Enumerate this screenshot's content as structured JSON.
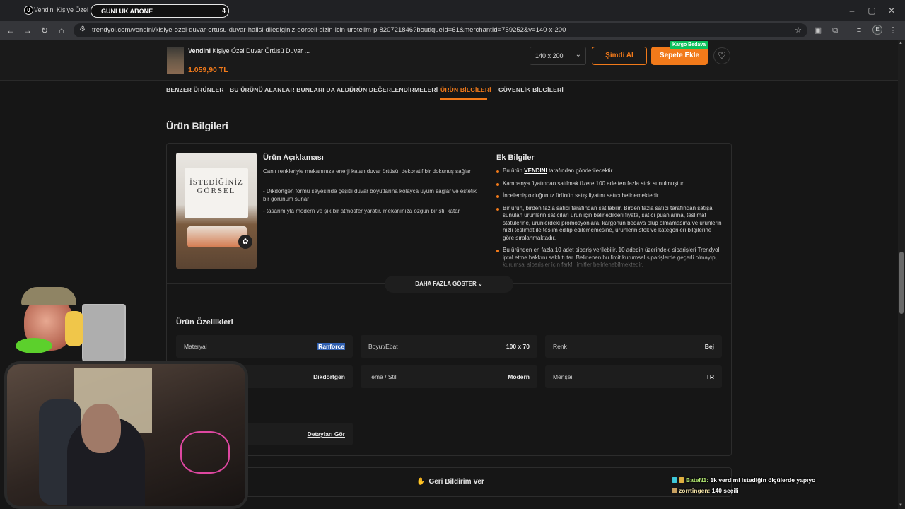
{
  "browser": {
    "tab_title": "Vendini Kişiye Özel Duvar Ö...",
    "overlay_goal_label": "GÜNLÜK ABONE",
    "overlay_goal_count": "4",
    "overlay_zero": "0",
    "url": "trendyol.com/vendini/kisiye-ozel-duvar-ortusu-duvar-halisi-dilediginiz-gorseli-sizin-icin-uretelim-p-820721846?boutiqueId=61&merchantId=759252&v=140-x-200",
    "profile_initial": "E"
  },
  "product_bar": {
    "brand": "Vendini",
    "title": "Kişiye Özel Duvar Örtüsü Duvar ...",
    "price": "1.059,90 TL",
    "size_value": "140 x 200",
    "buy_now_label": "Şimdi Al",
    "add_to_cart_label": "Sepete Ekle",
    "free_shipping_label": "Kargo Bedava"
  },
  "tabs": [
    {
      "label": "BENZER ÜRÜNLER"
    },
    {
      "label": "BU ÜRÜNÜ ALANLAR BUNLARI DA ALDI"
    },
    {
      "label": "ÜRÜN DEĞERLENDİRMELERİ"
    },
    {
      "label": "ÜRÜN BİLGİLERİ"
    },
    {
      "label": "GÜVENLİK BİLGİLERİ"
    }
  ],
  "active_tab": "ÜRÜN BİLGİLERİ",
  "section_title": "Ürün Bilgileri",
  "product_image": {
    "line1": "İSTEDİĞİNİZ",
    "line2": "GÖRSEL"
  },
  "description": {
    "title": "Ürün Açıklaması",
    "paragraphs": [
      "Canlı renkleriyle mekanınıza enerji katan duvar örtüsü, dekoratif bir dokunuş sağlar",
      "- Dikdörtgen formu sayesinde çeşitli duvar boyutlarına kolayca uyum sağlar ve estetik bir görünüm sunar",
      "- tasarımıyla modern ve şık bir atmosfer yaratır, mekanınıza özgün bir stil katar"
    ]
  },
  "extra_info": {
    "title": "Ek Bilgiler",
    "item1_pre": "Bu ürün",
    "item1_seller": "VENDİNİ",
    "item1_post": "tarafından gönderilecektir.",
    "items": [
      "Kampanya fiyatından satılmak üzere 100 adetten fazla stok sunulmuştur.",
      "İncelemiş olduğunuz ürünün satış fiyatını satıcı belirlemektedir.",
      "Bir ürün, birden fazla satıcı tarafından satılabilir. Birden fazla satıcı tarafından satışa sunulan ürünlerin satıcıları ürün için belirledikleri fiyata, satıcı puanlarına, teslimat statülerine, ürünlerdeki promosyonlara, kargonun bedava olup olmamasına ve ürünlerin hızlı teslimat ile teslim edilip edilememesine, ürünlerin stok ve kategorileri bilgilerine göre sıralanmaktadır.",
      "Bu üründen en fazla 10 adet sipariş verilebilir. 10 adedin üzerindeki siparişleri Trendyol iptal etme hakkını saklı tutar. Belirlenen bu limit kurumsal siparişlerde geçerli olmayıp, kurumsal siparişler için farklı limitler belirlenebilmektedir."
    ]
  },
  "show_more_label": "DAHA FAZLA GÖSTER",
  "features": {
    "title": "Ürün Özellikleri",
    "items": [
      {
        "key": "Materyal",
        "value": "Ranforce"
      },
      {
        "key": "Boyut/Ebat",
        "value": "100 x 70"
      },
      {
        "key": "Renk",
        "value": "Bej"
      },
      {
        "key": "",
        "value": "Dikdörtgen"
      },
      {
        "key": "Tema / Stil",
        "value": "Modern"
      },
      {
        "key": "Menşei",
        "value": "TR"
      }
    ]
  },
  "details_link": "Detayları Gör",
  "feedback_label": "Geri Bildirim Ver",
  "chat": [
    {
      "user": "BateN1:",
      "message": "1k verdimi istediğin ölçülerde yapıyo"
    },
    {
      "user": "zorrtingen:",
      "message": "140 seçili"
    }
  ],
  "colors": {
    "accent": "#f27a1a",
    "free_shipping": "#0bc15c",
    "background": "#161616"
  },
  "icons": [
    "back-icon",
    "forward-icon",
    "reload-icon",
    "home-icon",
    "site-info-icon",
    "star-icon",
    "heart-icon",
    "chevron-down-icon",
    "feedback-icon"
  ]
}
